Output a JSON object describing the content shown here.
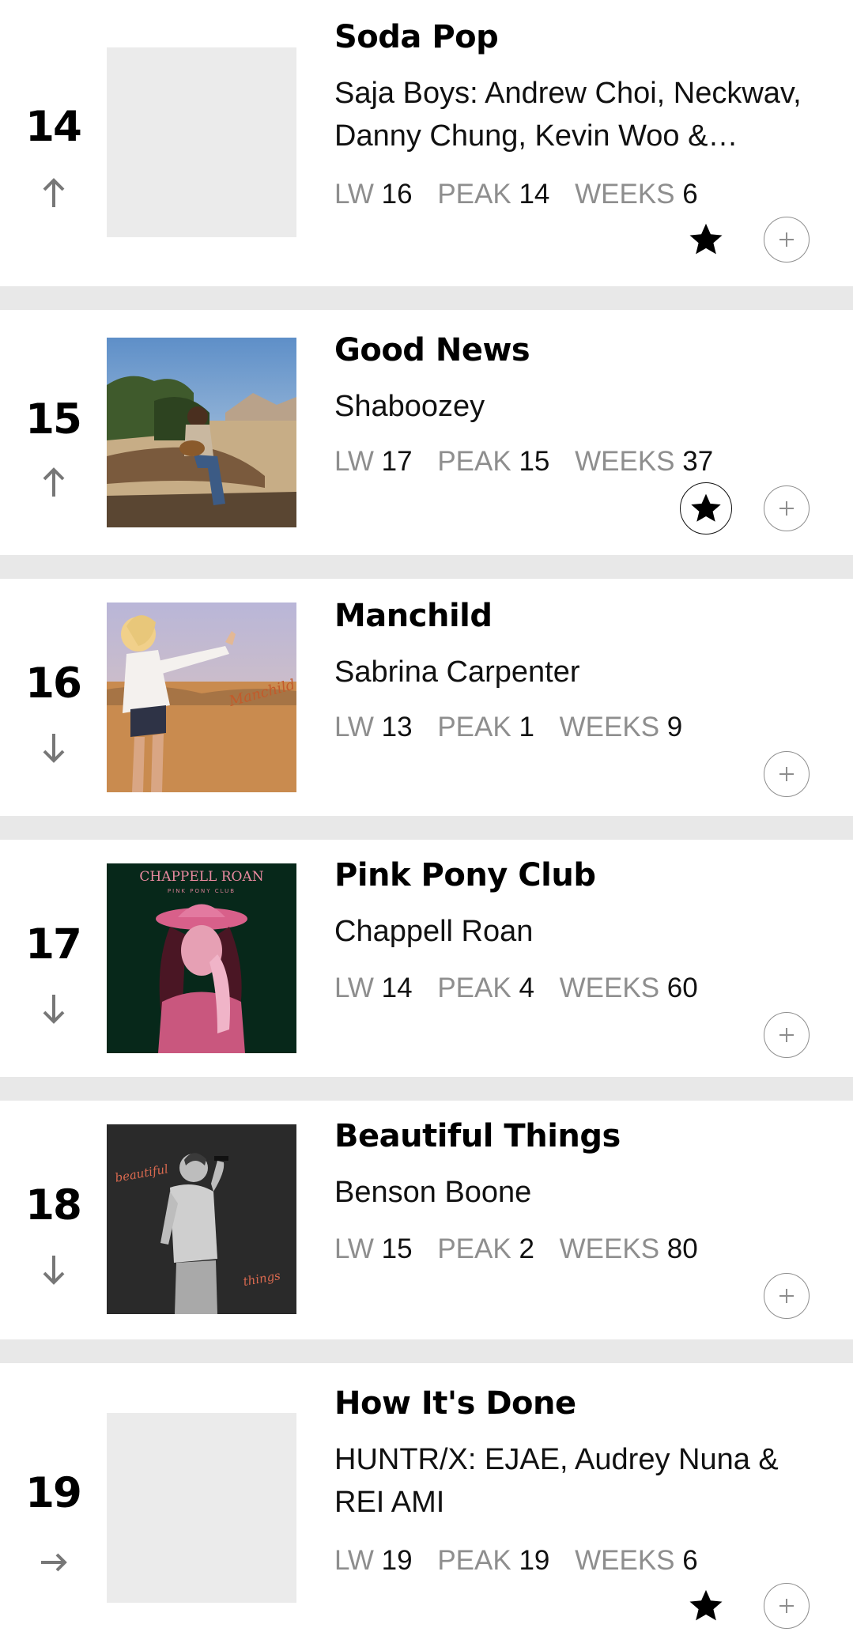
{
  "chart": {
    "stat_labels": {
      "lw": "LW",
      "peak": "PEAK",
      "weeks": "WEEKS"
    },
    "entries": [
      {
        "rank": "14",
        "movement": "up",
        "title": "Soda Pop",
        "artist": "Saja Boys: Andrew Choi, Neckwav, Danny Chung, Kevin Woo & samUIL Lee",
        "lw": "16",
        "peak": "14",
        "weeks": "6",
        "award": "star",
        "artwork": "placeholder"
      },
      {
        "rank": "15",
        "movement": "up",
        "title": "Good News",
        "artist": "Shaboozey",
        "lw": "17",
        "peak": "15",
        "weeks": "37",
        "award": "star-circled",
        "artwork": "good-news-cover"
      },
      {
        "rank": "16",
        "movement": "down",
        "title": "Manchild",
        "artist": "Sabrina Carpenter",
        "lw": "13",
        "peak": "1",
        "weeks": "9",
        "award": "none",
        "artwork": "manchild-cover"
      },
      {
        "rank": "17",
        "movement": "down",
        "title": "Pink Pony Club",
        "artist": "Chappell Roan",
        "lw": "14",
        "peak": "4",
        "weeks": "60",
        "award": "none",
        "artwork": "pink-pony-club-cover"
      },
      {
        "rank": "18",
        "movement": "down",
        "title": "Beautiful Things",
        "artist": "Benson Boone",
        "lw": "15",
        "peak": "2",
        "weeks": "80",
        "award": "none",
        "artwork": "beautiful-things-cover"
      },
      {
        "rank": "19",
        "movement": "steady",
        "title": "How It's Done",
        "artist": "HUNTR/X: EJAE, Audrey Nuna & REI AMI",
        "lw": "19",
        "peak": "19",
        "weeks": "6",
        "award": "star",
        "artwork": "placeholder"
      }
    ]
  },
  "artwork_text": {
    "pink_pony_club": {
      "artist_wordmark": "CHAPPELL ROAN",
      "title_wordmark": "PINK PONY CLUB"
    },
    "beautiful_things": {
      "word1": "beautiful",
      "word2": "things"
    },
    "manchild": {
      "script": "Manchild"
    }
  },
  "colors": {
    "divider": "#e8e8e8",
    "muted": "#8e8e8e",
    "placeholder": "#ebebeb"
  }
}
